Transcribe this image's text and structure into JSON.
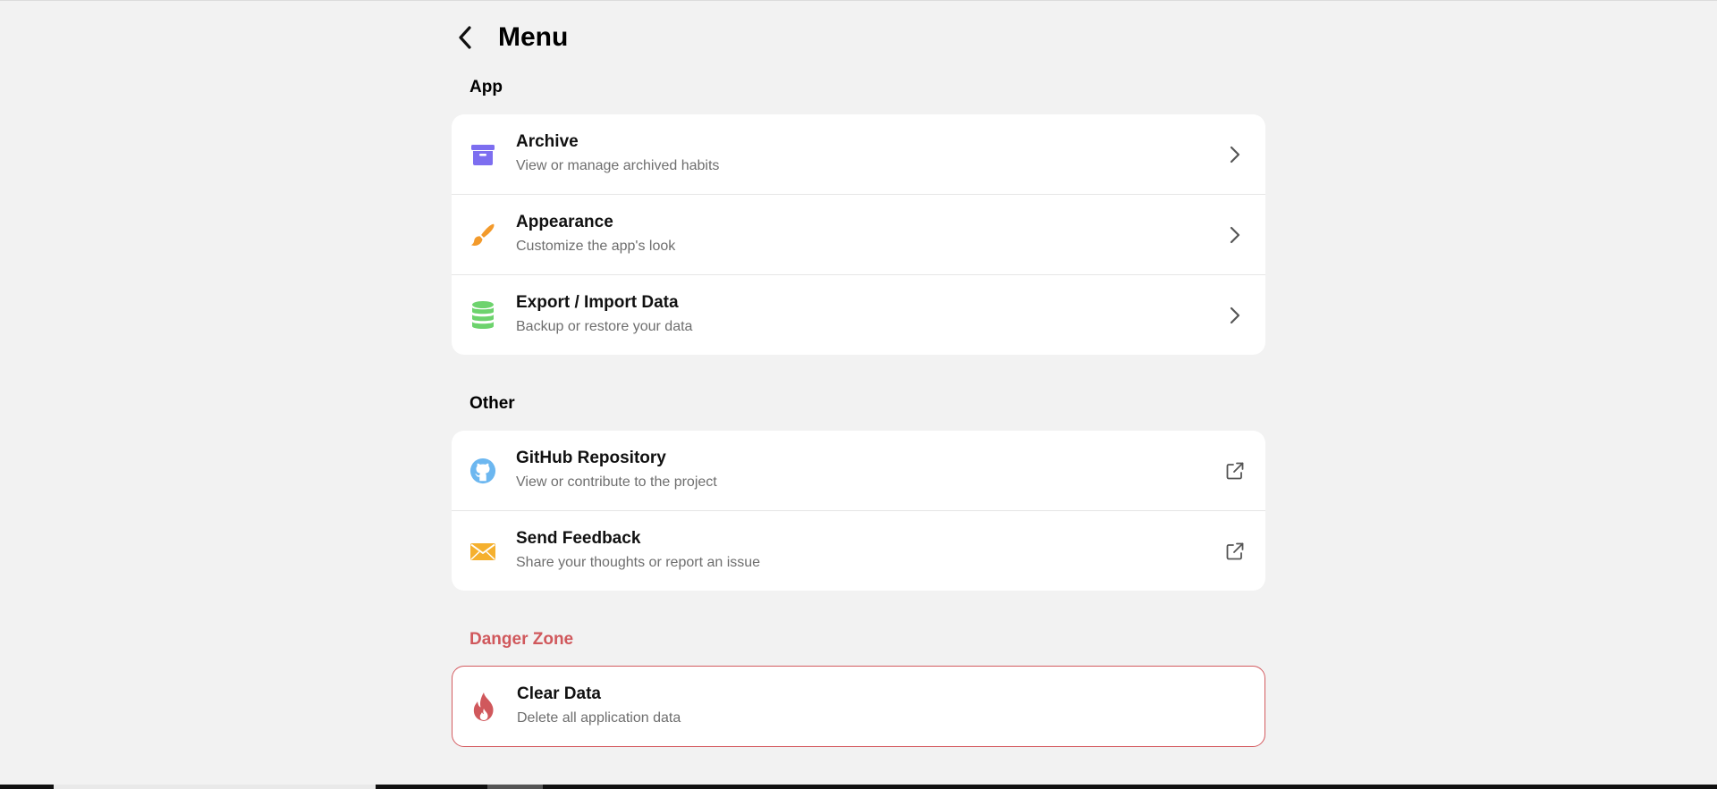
{
  "header": {
    "title": "Menu"
  },
  "sections": {
    "app": {
      "title": "App",
      "items": [
        {
          "label": "Archive",
          "desc": "View or manage archived habits",
          "icon": "archive-icon",
          "color": "#7d6ef0"
        },
        {
          "label": "Appearance",
          "desc": "Customize the app's look",
          "icon": "paintbrush-icon",
          "color": "#f39a2b"
        },
        {
          "label": "Export / Import Data",
          "desc": "Backup or restore your data",
          "icon": "database-icon",
          "color": "#6dd36d"
        }
      ]
    },
    "other": {
      "title": "Other",
      "items": [
        {
          "label": "GitHub Repository",
          "desc": "View or contribute to the project",
          "icon": "github-icon",
          "color": "#6cb7f0"
        },
        {
          "label": "Send Feedback",
          "desc": "Share your thoughts or report an issue",
          "icon": "envelope-icon",
          "color": "#f5b02e"
        }
      ]
    },
    "danger": {
      "title": "Danger Zone",
      "items": [
        {
          "label": "Clear Data",
          "desc": "Delete all application data",
          "icon": "fire-icon",
          "color": "#d0585c"
        }
      ]
    }
  }
}
